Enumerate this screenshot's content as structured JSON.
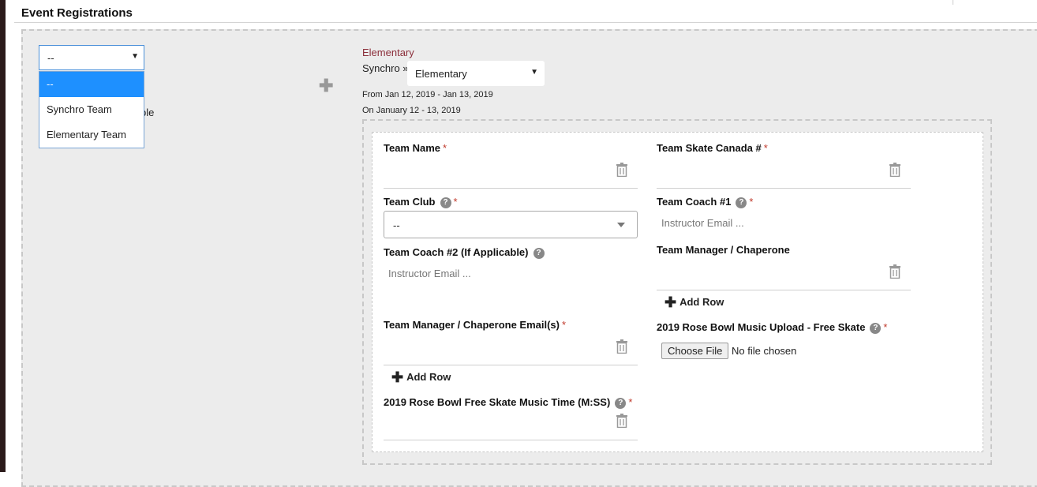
{
  "header": {
    "title": "Event Registrations"
  },
  "left_select": {
    "value": "--",
    "options": [
      "--",
      "Synchro Team",
      "Elementary Team"
    ],
    "behind_text": "ble"
  },
  "event": {
    "category": "Elementary",
    "breadcrumb": "Synchro »",
    "level_value": "Elementary",
    "date_range": "From Jan 12, 2019 - Jan 13, 2019",
    "date_on": "On January 12 - 13, 2019"
  },
  "form": {
    "team_name": "Team Name",
    "team_skate_canada": "Team Skate Canada #",
    "team_club": "Team Club",
    "team_club_value": "--",
    "team_coach_1": "Team Coach #1",
    "team_coach_1_placeholder": "Instructor Email ...",
    "team_coach_2": "Team Coach #2 (If Applicable)",
    "team_coach_2_placeholder": "Instructor Email ...",
    "team_manager": "Team Manager / Chaperone",
    "add_row": "Add Row",
    "manager_emails": "Team Manager / Chaperone Email(s)",
    "music_upload": "2019 Rose Bowl Music Upload - Free Skate",
    "choose_file": "Choose File",
    "no_file": "No file chosen",
    "music_time": "2019 Rose Bowl Free Skate Music Time (M:SS)"
  },
  "colors": {
    "accent_blue": "#1e90ff",
    "required_red": "#c0392b",
    "category_maroon": "#8b2e3a"
  },
  "icons": [
    "plus-icon",
    "trash-icon",
    "help-icon",
    "chevron-down-icon"
  ]
}
